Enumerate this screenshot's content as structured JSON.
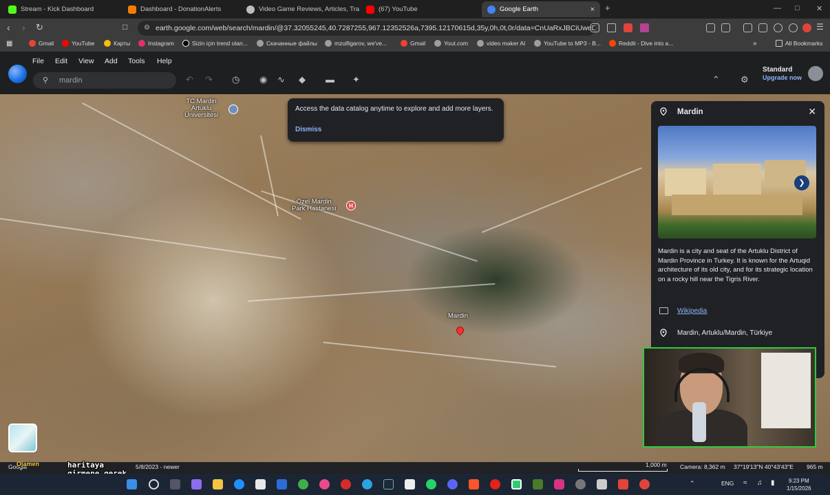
{
  "browser": {
    "tabs": [
      {
        "title": "Stream - Kick Dashboard",
        "favicon_color": "#53fc18"
      },
      {
        "title": "Dashboard - DonationAlerts",
        "favicon_color": "#f57c00"
      },
      {
        "title": "Video Game Reviews, Articles, Trailers",
        "favicon_color": "#bdbdbd"
      },
      {
        "title": "(67) YouTube",
        "favicon_color": "#ff0000"
      },
      {
        "title": "Google Earth",
        "favicon_color": "#4285f4",
        "active": true
      }
    ],
    "new_tab": "+",
    "close_tab": "×",
    "url": "earth.google.com/web/search/mardin/@37.32055245,40.7287255,967.12352526a,7395.12170615d,35y,0h,0t,0r/data=CnUaRxJBCiUweDQwM...",
    "bookmarks": [
      {
        "label": "Gmail",
        "color": "#ea4335"
      },
      {
        "label": "YouTube",
        "color": "#ff0000"
      },
      {
        "label": "Карты",
        "color": "#fbbc04"
      },
      {
        "label": "Instagram",
        "color": "#e1306c"
      },
      {
        "label": "Sizin için trend olan...",
        "color": "#000000"
      },
      {
        "label": "Скачанные файлы",
        "color": "#9e9e9e"
      },
      {
        "label": "mzulfigarov, we've...",
        "color": "#9e9e9e"
      },
      {
        "label": "Gmail",
        "color": "#ea4335"
      },
      {
        "label": "Yout.com",
        "color": "#9e9e9e"
      },
      {
        "label": "video maker AI",
        "color": "#9e9e9e"
      },
      {
        "label": "YouTube to MP3 - B...",
        "color": "#9e9e9e"
      },
      {
        "label": "Reddit - Dive into a...",
        "color": "#ff4500"
      }
    ],
    "all_bookmarks": "All Bookmarks"
  },
  "earth": {
    "menu": [
      "File",
      "Edit",
      "View",
      "Add",
      "Tools",
      "Help"
    ],
    "search_value": "mardin",
    "account": {
      "plan": "Standard",
      "upgrade": "Upgrade now"
    },
    "tooltip": {
      "message": "Access the data catalog anytime to explore and add more layers.",
      "dismiss": "Dismiss"
    },
    "map_labels": {
      "university": "TC Mardin\nArtuklu\nÜniversitesi",
      "hospital": "Özel Mardin\nPark Hastanesi",
      "hospital_icon": "H",
      "city": "Mardin"
    },
    "panel": {
      "title": "Mardin",
      "description": "Mardin is a city and seat of the Artuklu District of Mardin Province in Turkey. It is known for the Artuqid architecture of its old city, and for its strategic location on a rocky hill near the Tigris River.",
      "wikipedia": "Wikipedia",
      "address": "Mardin, Artuklu/Mardin, Türkiye"
    },
    "status": {
      "attribution": "Google",
      "imagery_date": "5/8/2023 - newer",
      "scale": "1,000 m",
      "camera": "Camera: 8,362 m",
      "coords": "37°19'13\"N 40°43'43\"E",
      "elevation": "965 m"
    }
  },
  "overlay": {
    "text": "haritaya\ngirmene gerek\nyok",
    "small": "Olamen"
  },
  "taskbar": {
    "lang": "ENG",
    "time": "9:23 PM",
    "date": "1/15/2026"
  }
}
